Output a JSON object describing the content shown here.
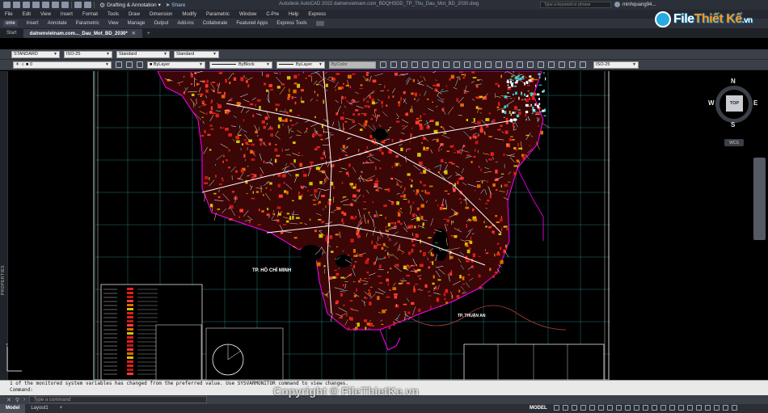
{
  "window": {
    "title": "Autodesk AutoCAD 2022    datnenvietnam.com_BDQHSDD_TP_Thu_Dau_Mot_BD_2030.dwg",
    "workspace": "Drafting & Annotation",
    "share_label": "Share",
    "search_placeholder": "Type a keyword or phrase",
    "user": "minhquang94..."
  },
  "menu": [
    "File",
    "Edit",
    "View",
    "Insert",
    "Format",
    "Tools",
    "Draw",
    "Dimension",
    "Modify",
    "Parametric",
    "Window",
    "C-Pre",
    "Help",
    "Express"
  ],
  "ribbon_tabs": [
    "ome",
    "Insert",
    "Annotate",
    "Parametric",
    "View",
    "Manage",
    "Output",
    "Add-ins",
    "Collaborate",
    "Featured Apps",
    "Express Tools"
  ],
  "file_tabs": {
    "start": "Start",
    "active": "datnenvietnam.com..._Dau_Mot_BD_2030*"
  },
  "toolbar": {
    "text_style": "STANDARD",
    "dim_style": "ISO-25",
    "table_style": "Standard",
    "mleader_style": "Standard",
    "layer": "0",
    "color": "ByLayer",
    "linetype": "ByBlock",
    "lineweight": "ByLayer",
    "plot_style": "ByColor",
    "dim_style_2": "ISO-25"
  },
  "sidebar": {
    "properties_label": "PROPERTIES"
  },
  "viewcube": {
    "top": "TOP",
    "n": "N",
    "s": "S",
    "e": "E",
    "w": "W",
    "wcs": "WCS"
  },
  "map": {
    "label_hcm": "TP. HỒ CHÍ MINH",
    "label_thuan_an": "TP. THUẬN AN"
  },
  "command": {
    "history_1": "1 of the monitored system variables has changed from the preferred value. Use SYSVARMONITOR command to view changes.",
    "history_2": "Command:",
    "placeholder": "Type a command"
  },
  "status": {
    "tabs": [
      "Model",
      "Layout1"
    ],
    "model_label": "MODEL"
  },
  "watermark": {
    "logo_part1": "File",
    "logo_part2": "Thiết Kế",
    "logo_suffix": ".vn",
    "copyright": "Copyright © FileThietKe.vn"
  },
  "colors": {
    "grid": "#2fa3a3",
    "streets": "#ffffff",
    "parcels": "#e0201c",
    "boundary": "#ff00ff",
    "accent": "#27a9e1"
  }
}
